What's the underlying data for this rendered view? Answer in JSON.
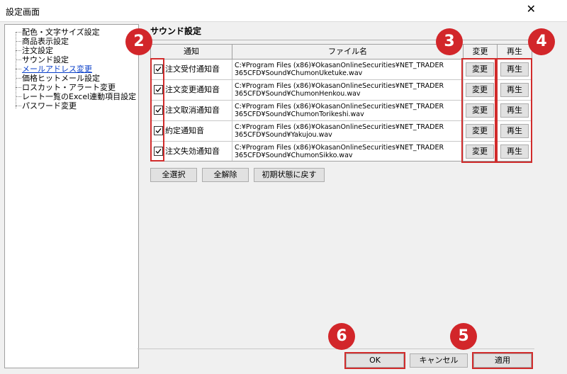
{
  "window": {
    "title": "設定画面",
    "close_glyph": "✕"
  },
  "tree": {
    "items": [
      {
        "label": "配色・文字サイズ設定"
      },
      {
        "label": "商品表示設定"
      },
      {
        "label": "注文設定"
      },
      {
        "label": "サウンド設定"
      },
      {
        "label": "メールアドレス変更"
      },
      {
        "label": "価格ヒットメール設定"
      },
      {
        "label": "ロスカット・アラート変更"
      },
      {
        "label": "レート一覧のExcel連動項目設定"
      },
      {
        "label": "パスワード変更"
      }
    ]
  },
  "panel": {
    "title": "サウンド設定",
    "columns": {
      "notify": "通知",
      "file": "ファイル名",
      "change": "変更",
      "play": "再生"
    },
    "rows": [
      {
        "checked": true,
        "label": "注文受付通知音",
        "path1": "C:¥Program Files (x86)¥OkasanOnlineSecurities¥NET_TRADER",
        "path2": "365CFD¥Sound¥ChumonUketuke.wav",
        "change_label": "変更",
        "play_label": "再生"
      },
      {
        "checked": true,
        "label": "注文変更通知音",
        "path1": "C:¥Program Files (x86)¥OkasanOnlineSecurities¥NET_TRADER",
        "path2": "365CFD¥Sound¥ChumonHenkou.wav",
        "change_label": "変更",
        "play_label": "再生"
      },
      {
        "checked": true,
        "label": "注文取消通知音",
        "path1": "C:¥Program Files (x86)¥OkasanOnlineSecurities¥NET_TRADER",
        "path2": "365CFD¥Sound¥ChumonTorikeshi.wav",
        "change_label": "変更",
        "play_label": "再生"
      },
      {
        "checked": true,
        "label": "約定通知音",
        "path1": "C:¥Program Files (x86)¥OkasanOnlineSecurities¥NET_TRADER",
        "path2": "365CFD¥Sound¥Yakujou.wav",
        "change_label": "変更",
        "play_label": "再生"
      },
      {
        "checked": true,
        "label": "注文失効通知音",
        "path1": "C:¥Program Files (x86)¥OkasanOnlineSecurities¥NET_TRADER",
        "path2": "365CFD¥Sound¥ChumonSikko.wav",
        "change_label": "変更",
        "play_label": "再生"
      }
    ],
    "buttons": {
      "select_all": "全選択",
      "deselect_all": "全解除",
      "reset": "初期状態に戻す"
    }
  },
  "footer": {
    "ok": "OK",
    "cancel": "キャンセル",
    "apply": "適用"
  },
  "callouts": {
    "b2": "2",
    "b3": "3",
    "b4": "4",
    "b5": "5",
    "b6": "6",
    "color": "#d2262a"
  }
}
